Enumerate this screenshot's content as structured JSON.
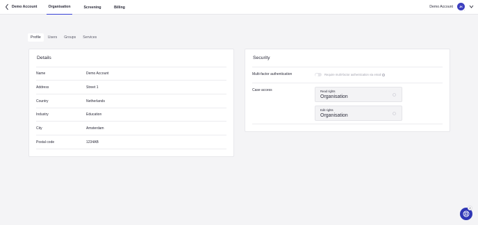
{
  "header": {
    "back_label": "Demo Account",
    "nav": [
      {
        "label": "Organisation",
        "active": true
      },
      {
        "label": "Screening",
        "active": false
      },
      {
        "label": "Billing",
        "active": false
      }
    ],
    "account_name": "Demo Account",
    "avatar_initials": "JK"
  },
  "tabs": [
    {
      "label": "Profile",
      "active": true
    },
    {
      "label": "Users",
      "active": false
    },
    {
      "label": "Groups",
      "active": false
    },
    {
      "label": "Services",
      "active": false
    }
  ],
  "details": {
    "title": "Details",
    "rows": [
      {
        "label": "Name",
        "value": "Demo Account"
      },
      {
        "label": "Address",
        "value": "Street 1"
      },
      {
        "label": "Country",
        "value": "Netherlands"
      },
      {
        "label": "Industry",
        "value": "Education"
      },
      {
        "label": "City",
        "value": "Amsterdam"
      },
      {
        "label": "Postal code",
        "value": "1234AB"
      }
    ]
  },
  "security": {
    "title": "Security",
    "mfa_label": "Multi-factor authentication",
    "mfa_toggle_label": "Require multi-factor authentication via email",
    "mfa_enabled": false,
    "case_access_label": "Case access",
    "read_rights": {
      "label": "Read rights",
      "value": "Organisation"
    },
    "edit_rights": {
      "label": "Edit rights",
      "value": "Organisation"
    }
  },
  "help": {
    "badge_count": "2"
  },
  "colors": {
    "accent": "#3640d6",
    "help_button": "#2f36b5",
    "background": "#f4f4f6"
  }
}
